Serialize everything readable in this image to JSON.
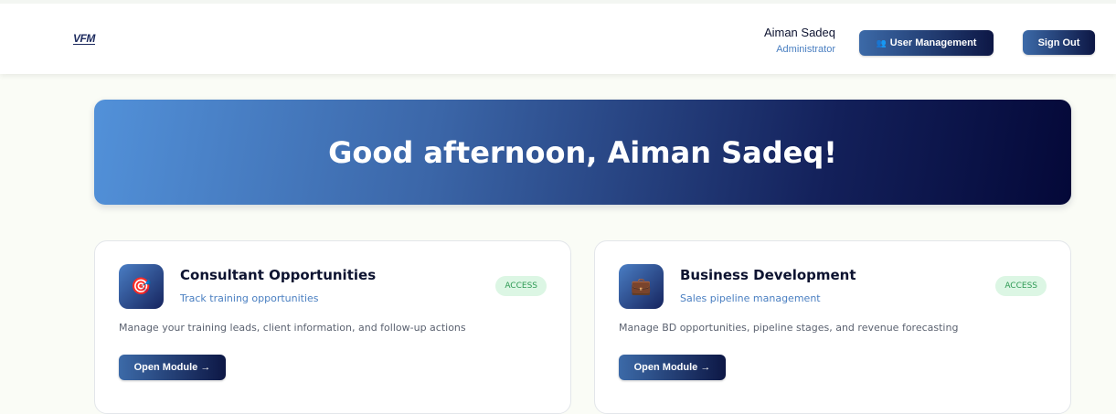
{
  "header": {
    "logo": "VFM",
    "user_name": "Aiman Sadeq",
    "user_role": "Administrator",
    "user_management_label": "User Management",
    "sign_out_label": "Sign Out"
  },
  "hero": {
    "greeting": "Good afternoon, Aiman Sadeq!"
  },
  "cards": [
    {
      "title": "Consultant Opportunities",
      "subtitle": "Track training opportunities",
      "badge": "ACCESS",
      "description": "Manage your training leads, client information, and follow-up actions",
      "button": "Open Module →",
      "icon": "target-icon"
    },
    {
      "title": "Business Development",
      "subtitle": "Sales pipeline management",
      "badge": "ACCESS",
      "description": "Manage BD opportunities, pipeline stages, and revenue forecasting",
      "button": "Open Module →",
      "icon": "briefcase-icon"
    }
  ],
  "colors": {
    "accent_dark": "#0d1745",
    "accent_light": "#4a7fc1",
    "badge_bg": "#dcf6e4",
    "badge_text": "#2e9a55"
  }
}
